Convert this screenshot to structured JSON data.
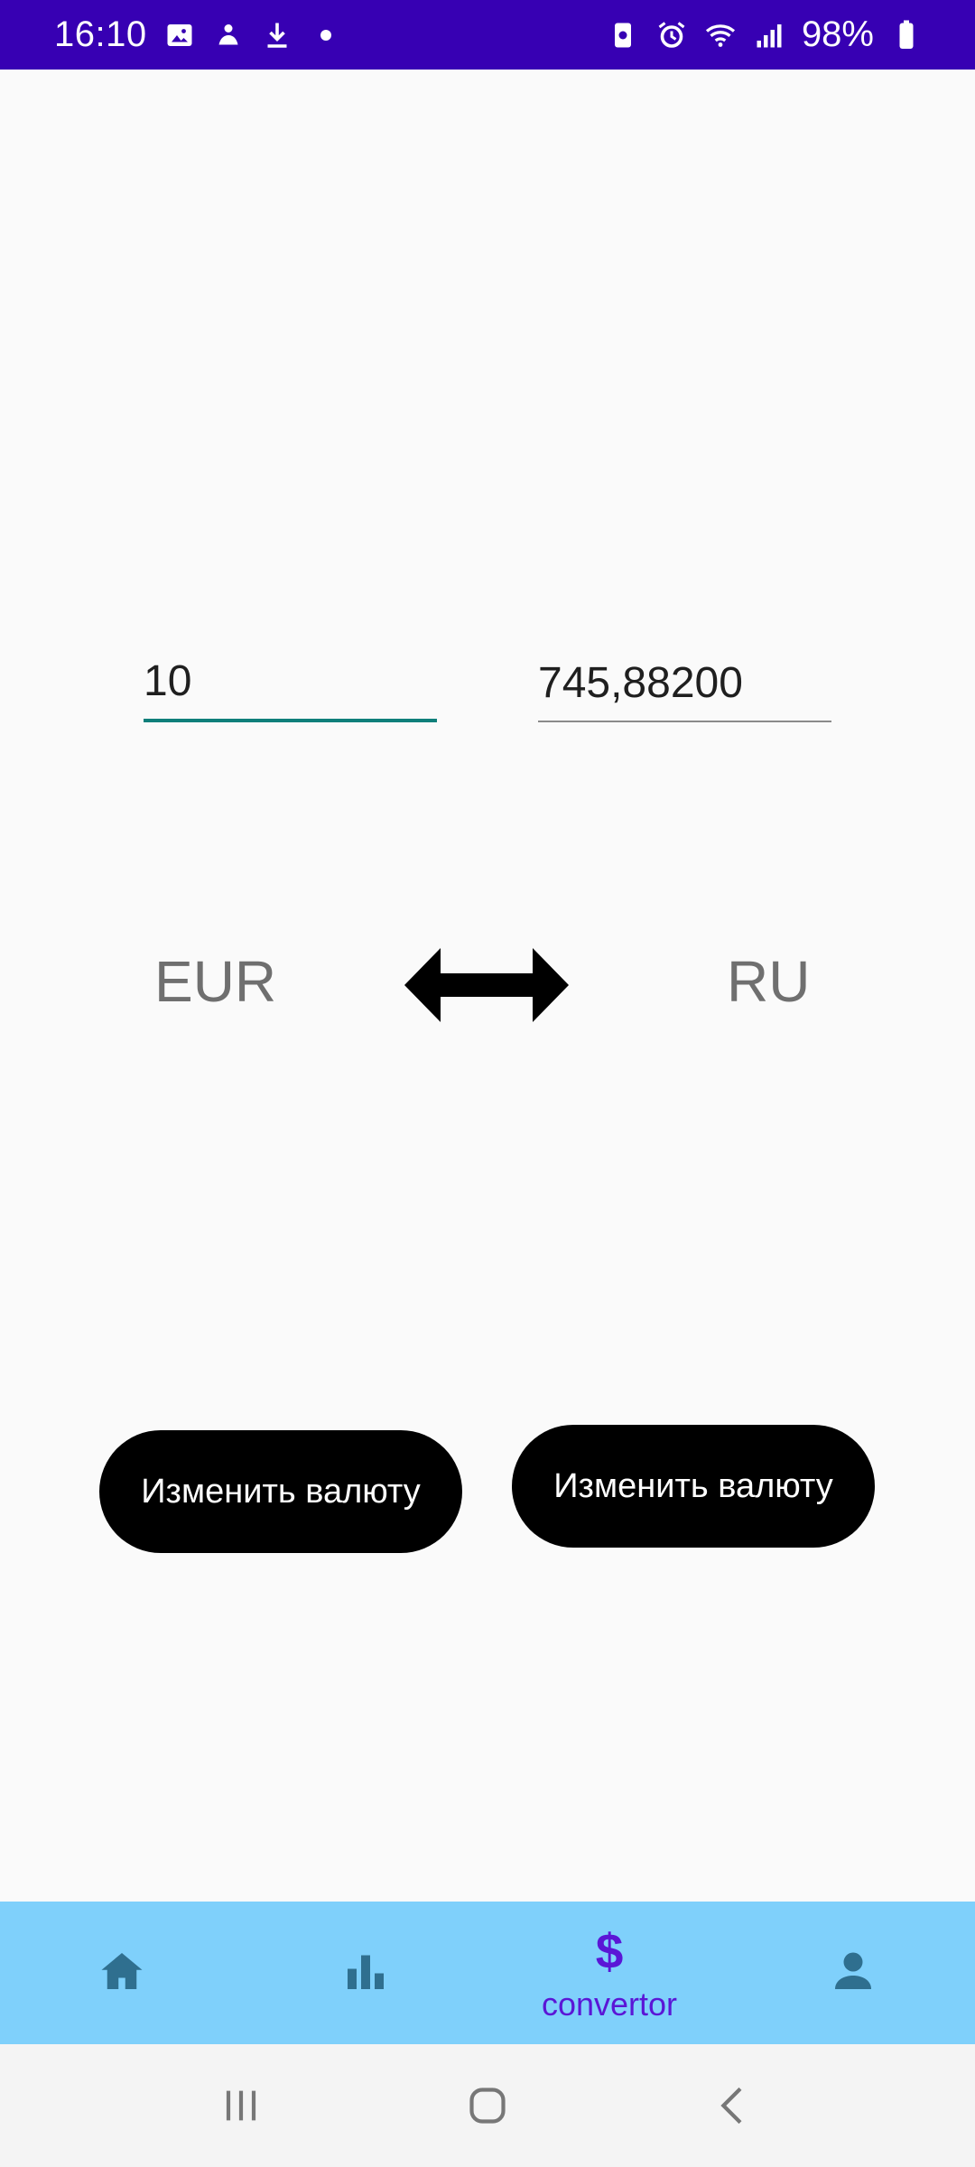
{
  "status_bar": {
    "time": "16:10",
    "battery": "98%"
  },
  "converter": {
    "amount_from": "10",
    "amount_to": "745,88200",
    "currency_from": "EUR",
    "currency_to": "RU",
    "change_button_left": "Изменить валюту",
    "change_button_right": "Изменить валюту"
  },
  "bottom_nav": {
    "items": [
      {
        "icon": "home-icon"
      },
      {
        "icon": "bar-chart-icon"
      },
      {
        "icon": "dollar-icon",
        "label": "convertor"
      },
      {
        "icon": "person-icon"
      }
    ],
    "active_color": "#5b16d6",
    "background": "#7fd0fb"
  },
  "system_nav": {
    "items": [
      "recents-icon",
      "home-button-icon",
      "back-icon"
    ]
  },
  "colors": {
    "status_bar": "#3700b3",
    "accent": "#0f7f7a",
    "button": "#000000"
  }
}
